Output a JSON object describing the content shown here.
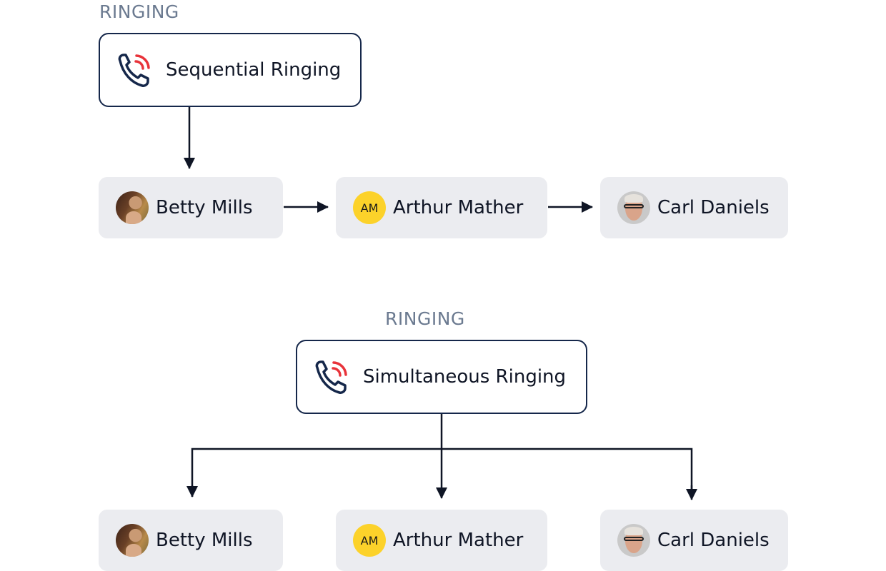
{
  "sequential": {
    "section_label": "RINGING",
    "mode_label": "Sequential Ringing",
    "mode_icon": "phone-ringing-icon",
    "people": [
      {
        "name": "Betty Mills",
        "avatar_type": "photo",
        "avatar_icon": "avatar-photo"
      },
      {
        "name": "Arthur Mather",
        "avatar_type": "initials",
        "initials": "AM"
      },
      {
        "name": "Carl Daniels",
        "avatar_type": "photo",
        "avatar_icon": "avatar-photo"
      }
    ]
  },
  "simultaneous": {
    "section_label": "RINGING",
    "mode_label": "Simultaneous Ringing",
    "mode_icon": "phone-ringing-icon",
    "people": [
      {
        "name": "Betty Mills",
        "avatar_type": "photo",
        "avatar_icon": "avatar-photo"
      },
      {
        "name": "Arthur Mather",
        "avatar_type": "initials",
        "initials": "AM"
      },
      {
        "name": "Carl Daniels",
        "avatar_type": "photo",
        "avatar_icon": "avatar-photo"
      }
    ]
  },
  "colors": {
    "border": "#15274a",
    "label": "#6b7a90",
    "card_bg": "#ebecf0",
    "ring_waves": "#e8333a",
    "initials_avatar": "#fcd22a",
    "arrow": "#0f1525"
  }
}
